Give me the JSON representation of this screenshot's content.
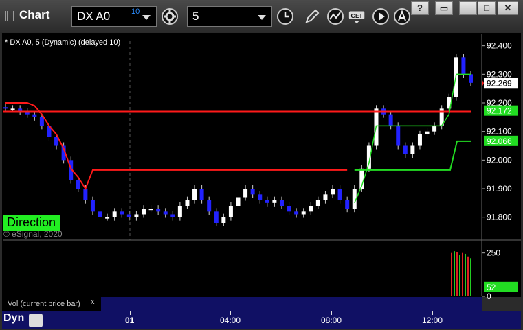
{
  "app": {
    "title": "Chart"
  },
  "toolbar": {
    "symbol": "DX A0",
    "symbol_superscript": "10",
    "interval": "5"
  },
  "chart": {
    "status": "* DX A0, 5 (Dynamic) (delayed 10)",
    "direction_label": "Direction",
    "copyright": "© eSignal, 2020",
    "price_ticks": [
      "92.400",
      "92.300",
      "92.200",
      "92.100",
      "92.000",
      "91.900",
      "91.800"
    ],
    "price_badges": {
      "last": "92.269",
      "upper": "92.172",
      "lower": "92.066"
    },
    "vol_ticks": [
      "250",
      "0"
    ],
    "vol_badge": "52",
    "vol_label": "Vol (current price bar)",
    "vol_close": "x",
    "time_ticks": [
      "01",
      "04:00",
      "08:00",
      "12:00"
    ],
    "dyn_label": "Dyn",
    "colors": {
      "up": "#ffffff",
      "down": "#2222ff",
      "red_line": "#ff1a1a",
      "green_line": "#22dd22",
      "background": "#000000",
      "axis_bg": "#101064"
    }
  },
  "chart_data": {
    "type": "line",
    "series": [
      {
        "values": [
          92.18,
          92.18,
          92.17,
          92.16,
          92.15,
          92.12,
          92.08,
          92.05,
          92.0,
          91.93,
          91.9,
          91.86,
          91.82,
          91.8,
          91.8,
          91.82,
          91.81,
          91.8,
          91.81,
          91.83,
          91.83,
          91.82,
          91.81,
          91.8,
          91.84,
          91.86,
          91.9,
          91.86,
          91.82,
          91.78,
          91.8,
          91.84,
          91.87,
          91.9,
          91.88,
          91.86,
          91.85,
          91.86,
          91.84,
          91.82,
          91.81,
          91.82,
          91.84,
          91.86,
          91.88,
          91.9,
          91.86,
          91.83,
          91.9,
          91.97,
          92.05,
          92.18,
          92.16,
          92.12,
          92.05,
          92.02,
          92.05,
          92.09,
          92.1,
          92.12,
          92.18,
          92.22,
          92.36,
          92.3,
          92.27
        ]
      },
      {
        "values": [
          92.17,
          92.17,
          92.17,
          92.17,
          92.17,
          92.17,
          92.17,
          92.17,
          92.17,
          92.17,
          92.17,
          92.17,
          92.17,
          92.17,
          92.17,
          92.17,
          92.17,
          92.17,
          92.17,
          92.17,
          92.17,
          92.17,
          92.17,
          92.17,
          92.17,
          92.17,
          92.17,
          92.17,
          92.17,
          92.17,
          92.17,
          92.17,
          92.17,
          92.17,
          92.17,
          92.17,
          92.17,
          92.17,
          92.17,
          92.17,
          92.17,
          92.17,
          92.17,
          92.17,
          92.17,
          92.17,
          92.17,
          92.17,
          92.17,
          92.17,
          92.17,
          92.17,
          92.17,
          92.17,
          92.17,
          92.17,
          92.17,
          92.17,
          92.17,
          92.17,
          92.17,
          92.17,
          92.17,
          92.17,
          92.17
        ]
      }
    ],
    "ylim": [
      91.72,
      92.44
    ],
    "vol_ylim": [
      0,
      300
    ]
  }
}
